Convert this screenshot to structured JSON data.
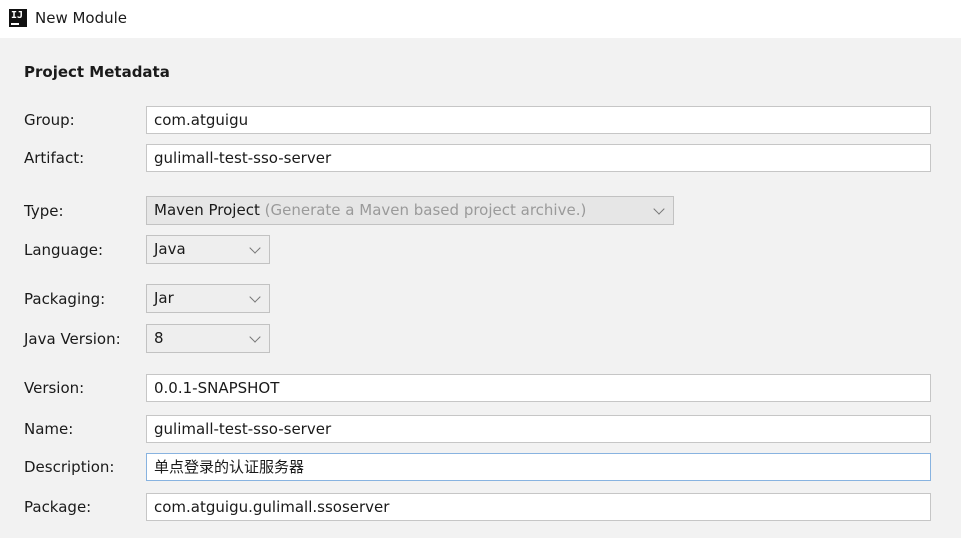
{
  "window": {
    "title": "New Module",
    "icon": "intellij-icon",
    "icon_text": "IJ"
  },
  "metadata": {
    "section_title": "Project Metadata",
    "group": {
      "label": "Group:",
      "value": "com.atguigu"
    },
    "artifact": {
      "label": "Artifact:",
      "value": "gulimall-test-sso-server"
    },
    "type": {
      "label": "Type:",
      "value": "Maven Project",
      "hint": "(Generate a Maven based project archive.)"
    },
    "language": {
      "label": "Language:",
      "value": "Java"
    },
    "packaging": {
      "label": "Packaging:",
      "value": "Jar"
    },
    "java_version": {
      "label": "Java Version:",
      "value": "8"
    },
    "version": {
      "label": "Version:",
      "value": "0.0.1-SNAPSHOT"
    },
    "name": {
      "label": "Name:",
      "value": "gulimall-test-sso-server"
    },
    "description": {
      "label": "Description:",
      "value": "单点登录的认证服务器"
    },
    "package": {
      "label": "Package:",
      "value": "com.atguigu.gulimall.ssoserver"
    }
  },
  "colors": {
    "window_background": "#f2f2f2",
    "field_border": "#c6c6c6",
    "focus_border": "#88b3e0",
    "hint_text": "#9a9a9a"
  }
}
